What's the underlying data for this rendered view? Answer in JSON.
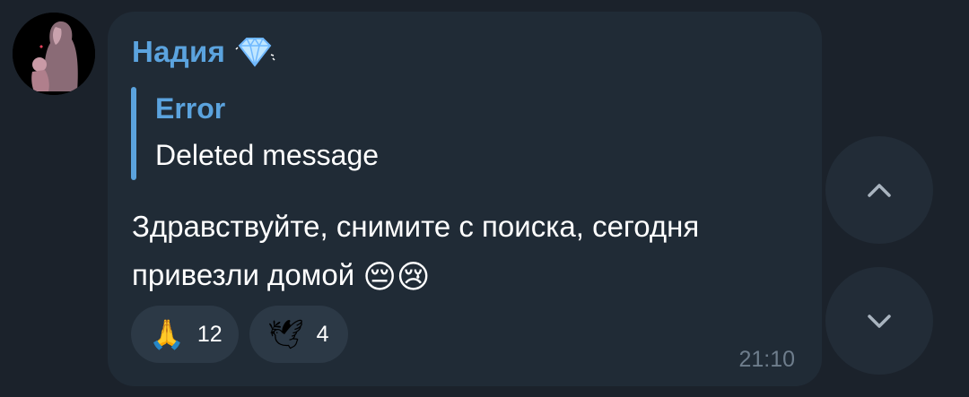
{
  "message": {
    "sender": {
      "name": "Надия",
      "badge_icon": "diamond-icon",
      "name_color": "#5ba3de"
    },
    "avatar": {
      "icon": "avatar-silhouette-icon"
    },
    "reply": {
      "title": "Error",
      "text": "Deleted message"
    },
    "text": "Здравствуйте, снимите с поиска, сегодня привезли домой",
    "text_emojis": [
      "😔",
      "😢"
    ],
    "reactions": [
      {
        "emoji": "🙏",
        "count": "12"
      },
      {
        "emoji": "🕊",
        "count": "4"
      }
    ],
    "time": "21:10"
  },
  "controls": {
    "scroll_up_icon": "chevron-up-icon",
    "scroll_down_icon": "chevron-down-icon"
  },
  "colors": {
    "background": "#1b222b",
    "bubble": "#202b36",
    "accent": "#5ba3de",
    "reaction_bg": "#2c3946"
  }
}
